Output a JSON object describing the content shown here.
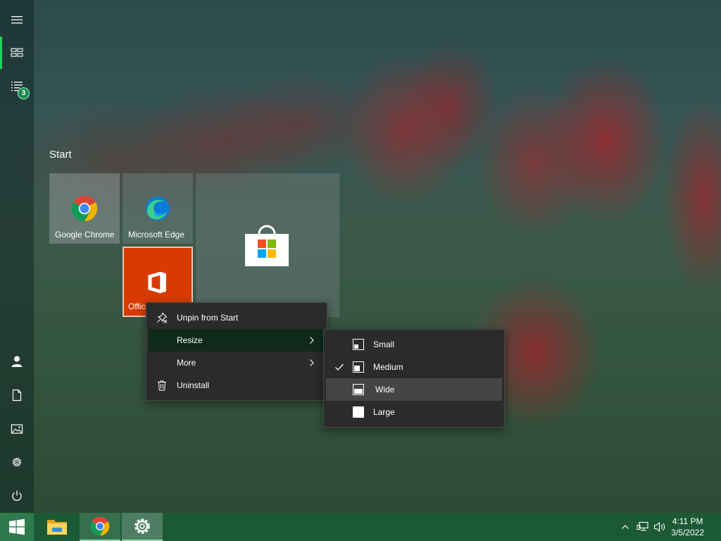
{
  "start": {
    "title": "Start",
    "badge_count": "3",
    "tiles": {
      "chrome": "Google Chrome",
      "edge": "Microsoft Edge",
      "store": "",
      "office": "Office"
    }
  },
  "context_menu": {
    "unpin": "Unpin from Start",
    "resize": "Resize",
    "more": "More",
    "uninstall": "Uninstall"
  },
  "resize_submenu": {
    "small": "Small",
    "medium": "Medium",
    "wide": "Wide",
    "large": "Large",
    "selected": "Medium"
  },
  "taskbar": {
    "time": "4:11 PM",
    "date": "3/5/2022"
  },
  "colors": {
    "accent": "#1fd35a",
    "taskbar": "#1c5a36",
    "office_tile": "#d83b01",
    "menu_bg": "#2b2b2b"
  },
  "icons": [
    "hamburger-icon",
    "all-tiles-icon",
    "list-icon",
    "user-icon",
    "document-icon",
    "pictures-icon",
    "gear-icon",
    "power-icon",
    "windows-logo-icon",
    "folder-icon",
    "chrome-icon",
    "edge-icon",
    "store-icon",
    "office-icon",
    "unpin-icon",
    "trash-icon",
    "chevron-right-icon",
    "checkmark-icon",
    "chevron-up-icon",
    "network-icon",
    "volume-icon"
  ]
}
